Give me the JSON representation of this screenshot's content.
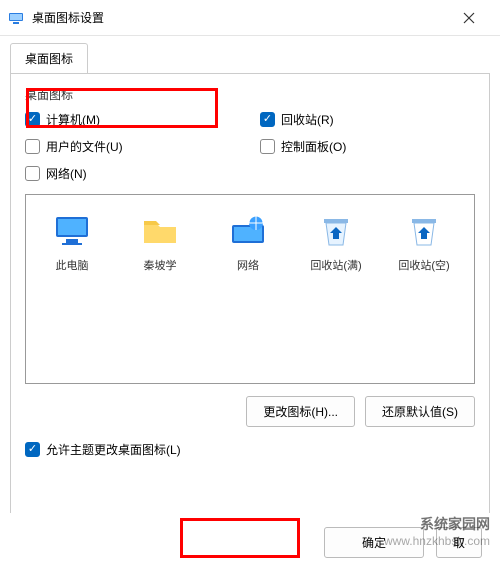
{
  "window": {
    "title": "桌面图标设置"
  },
  "tabs": {
    "main": "桌面图标"
  },
  "group": {
    "label": "桌面图标"
  },
  "checks": {
    "computer": {
      "label": "计算机(M)",
      "checked": true
    },
    "recycle": {
      "label": "回收站(R)",
      "checked": true
    },
    "userfiles": {
      "label": "用户的文件(U)",
      "checked": false
    },
    "cpanel": {
      "label": "控制面板(O)",
      "checked": false
    },
    "network": {
      "label": "网络(N)",
      "checked": false
    }
  },
  "icons": {
    "thispc": "此电脑",
    "qinpo": "秦坡学",
    "network": "网络",
    "binfull": "回收站(满)",
    "binempty": "回收站(空)"
  },
  "buttons": {
    "change": "更改图标(H)...",
    "restore": "还原默认值(S)",
    "ok": "确定",
    "cancel": "取"
  },
  "allowTheme": {
    "label": "允许主题更改桌面图标(L)",
    "checked": true
  },
  "watermark": {
    "main": "系统家园网",
    "sub": "www.hnzkhbsb.com"
  }
}
